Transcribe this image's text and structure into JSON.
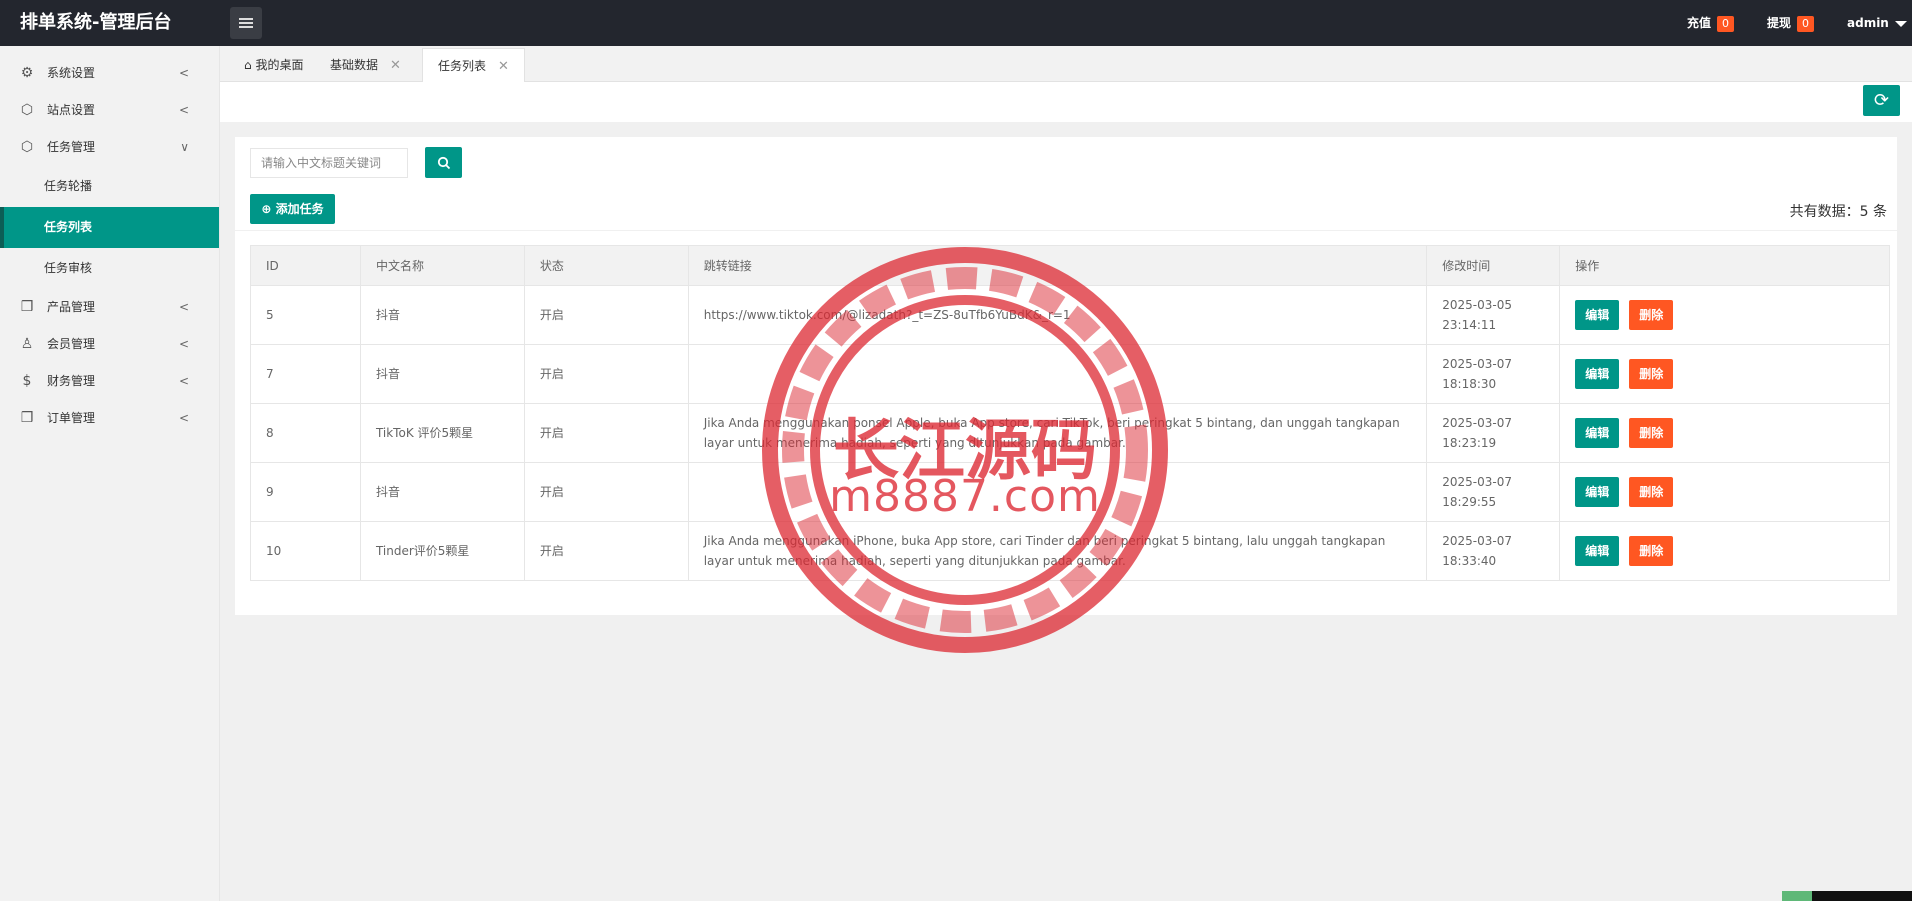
{
  "header": {
    "title": "排单系统-管理后台",
    "recharge_label": "充值",
    "recharge_count": "0",
    "withdraw_label": "提现",
    "withdraw_count": "0",
    "user": "admin"
  },
  "sidebar": {
    "items": [
      {
        "label": "系统设置",
        "icon": "gear-icon"
      },
      {
        "label": "站点设置",
        "icon": "site-icon"
      },
      {
        "label": "任务管理",
        "icon": "task-icon"
      },
      {
        "label": "产品管理",
        "icon": "cube-icon"
      },
      {
        "label": "会员管理",
        "icon": "user-icon"
      },
      {
        "label": "财务管理",
        "icon": "dollar-icon"
      },
      {
        "label": "订单管理",
        "icon": "order-icon"
      }
    ],
    "sub_items": [
      "任务轮播",
      "任务列表",
      "任务审核"
    ]
  },
  "tabs": [
    {
      "label": "我的桌面"
    },
    {
      "label": "基础数据"
    },
    {
      "label": "任务列表"
    }
  ],
  "search": {
    "placeholder": "请输入中文标题关键词"
  },
  "add_button": "添加任务",
  "total": "共有数据：5 条",
  "table": {
    "columns": [
      "ID",
      "中文名称",
      "状态",
      "跳转链接",
      "修改时间",
      "操作"
    ],
    "rows": [
      {
        "id": "5",
        "name": "抖音",
        "status": "开启",
        "link": "https://www.tiktok.com/@lizadath?_t=ZS-8uTfb6YuBdK&_r=1",
        "time": "2025-03-05 23:14:11"
      },
      {
        "id": "7",
        "name": "抖音",
        "status": "开启",
        "link": "",
        "time": "2025-03-07 18:18:30"
      },
      {
        "id": "8",
        "name": "TikToK 评价5颗星",
        "status": "开启",
        "link": "Jika Anda menggunakan ponsel Apple, buka App store, cari TikTok, beri peringkat 5 bintang, dan unggah tangkapan layar untuk menerima hadiah, seperti yang ditunjukkan pada gambar.",
        "time": "2025-03-07 18:23:19"
      },
      {
        "id": "9",
        "name": "抖音",
        "status": "开启",
        "link": "",
        "time": "2025-03-07 18:29:55"
      },
      {
        "id": "10",
        "name": "Tinder评价5颗星",
        "status": "开启",
        "link": "Jika Anda menggunakan iPhone, buka App store, cari Tinder dan beri peringkat 5 bintang, lalu unggah tangkapan layar untuk menerima hadiah, seperti yang ditunjukkan pada gambar.",
        "time": "2025-03-07 18:33:40"
      }
    ],
    "edit_label": "编辑",
    "delete_label": "删除"
  },
  "watermark": {
    "line1": "长江源码",
    "line2": "m8887.com"
  },
  "colors": {
    "primary": "#009688",
    "danger": "#ff5722",
    "header": "#23262e",
    "watermark": "#dc2832"
  }
}
